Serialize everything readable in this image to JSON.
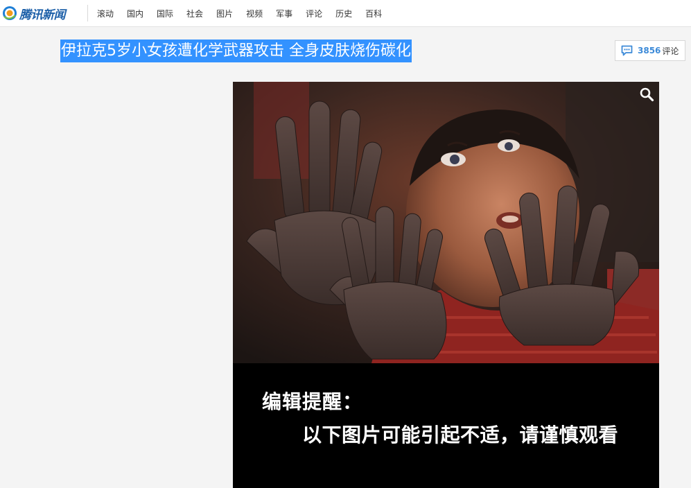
{
  "brand": {
    "name": "腾讯新闻",
    "colors": {
      "logo_text": "#1c5fa8",
      "logo_blue": "#1e7fd6",
      "logo_orange": "#f29b1b"
    }
  },
  "nav": {
    "items": [
      {
        "label": "滚动"
      },
      {
        "label": "国内"
      },
      {
        "label": "国际"
      },
      {
        "label": "社会"
      },
      {
        "label": "图片"
      },
      {
        "label": "视频"
      },
      {
        "label": "军事"
      },
      {
        "label": "评论"
      },
      {
        "label": "历史"
      },
      {
        "label": "百科"
      }
    ]
  },
  "article": {
    "title": "伊拉克5岁小女孩遭化学武器攻击 全身皮肤烧伤碳化",
    "title_highlight_color": "#3392ff",
    "comments": {
      "count": "3856",
      "label": "评论",
      "icon": "comment-bubble-icon",
      "accent": "#3c8ad8"
    }
  },
  "photo": {
    "zoom_icon": "magnifier-icon",
    "notice": {
      "heading": "编辑提醒：",
      "body": "以下图片可能引起不适，请谨慎观看"
    }
  }
}
